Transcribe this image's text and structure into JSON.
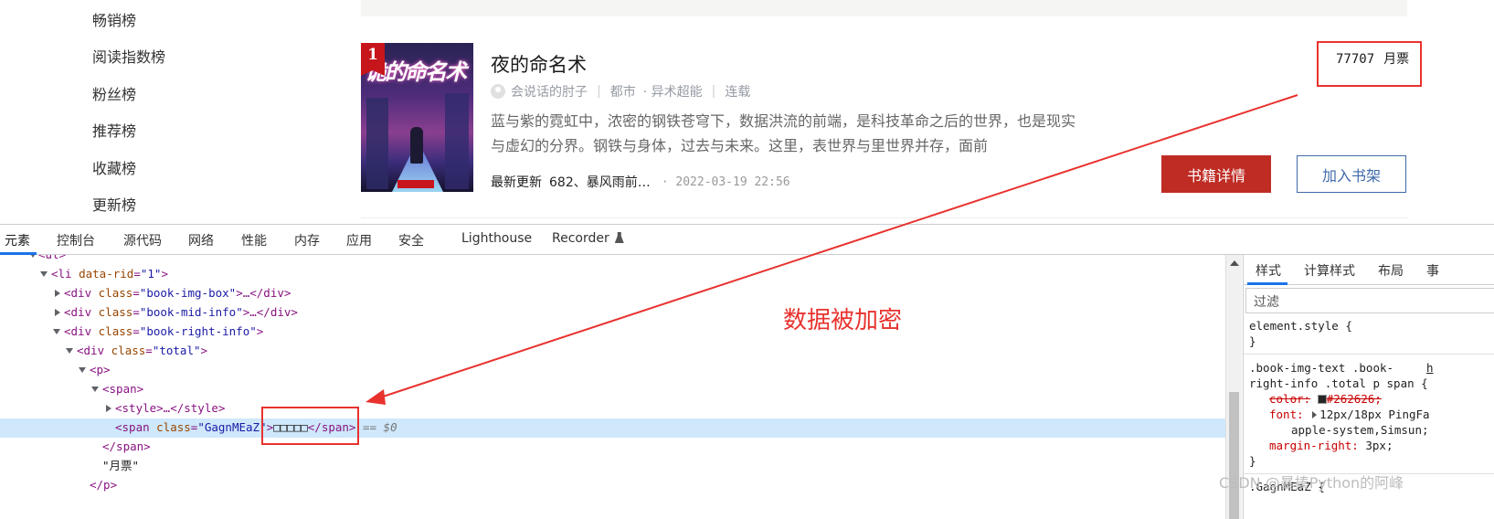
{
  "rank_list": [
    "畅销榜",
    "阅读指数榜",
    "粉丝榜",
    "推荐榜",
    "收藏榜",
    "更新榜"
  ],
  "book": {
    "rank": "1",
    "cover_art_text": "诡的命名术",
    "title": "夜的命名术",
    "author": "会说话的肘子",
    "category": "都市",
    "subcategory": "· 异术超能",
    "status": "连载",
    "description": "蓝与紫的霓虹中，浓密的钢铁苍穹下，数据洪流的前端，是科技革命之后的世界，也是现实与虚幻的分界。钢铁与身体，过去与未来。这里，表世界与里世界并存，面前",
    "update_label": "最新更新",
    "update_chapter": "682、暴风雨前…",
    "update_time": "· 2022-03-19 22:56",
    "votes_num": "77707",
    "votes_unit": "月票",
    "btn_detail": "书籍详情",
    "btn_shelf": "加入书架"
  },
  "devtools": {
    "tabs": [
      "元素",
      "控制台",
      "源代码",
      "网络",
      "性能",
      "内存",
      "应用",
      "安全",
      "Lighthouse",
      "Recorder"
    ],
    "active_tab": "元素",
    "tree": {
      "l0": "<ul>",
      "l1_open": "<li ",
      "l1_attr": "data-rid",
      "l1_val": "\"1\"",
      "l1_close": ">",
      "l2": "book-img-box",
      "l3": "book-mid-info",
      "l4": "book-right-info",
      "l5": "total",
      "l6": "<p>",
      "l7": "<span>",
      "l8": "<style>…</style>",
      "l9_class": "\"GagnMEaZ\"",
      "l9_text": "□□□□□",
      "l9_eq": "== $0",
      "l10": "</span>",
      "l11": "\"月票\"",
      "l12": "</p>",
      "collapsed": ">…</div>"
    },
    "styles_tabs": [
      "样式",
      "计算样式",
      "布局",
      "事"
    ],
    "filter_placeholder": "过滤",
    "rule1_selector": "element.style {",
    "rule1_close": "}",
    "rule2_selector_a": ".book-img-text .book-",
    "rule2_selector_b": "right-info .total p span {",
    "rule2_link": "h",
    "rule2_color_prop": "color:",
    "rule2_color_val": "#262626;",
    "rule2_font_prop": "font:",
    "rule2_font_val": "12px/18px PingFa",
    "rule2_font_val2": "apple-system,Simsun;",
    "rule2_margin_prop": "margin-right:",
    "rule2_margin_val": "3px;",
    "rule2_close": "}",
    "rule3_selector": ".GagnMEaZ {"
  },
  "annotation": {
    "label": "数据被加密",
    "color": "#e8322e"
  },
  "watermark": "CSDN @暴揍Python的阿峰"
}
